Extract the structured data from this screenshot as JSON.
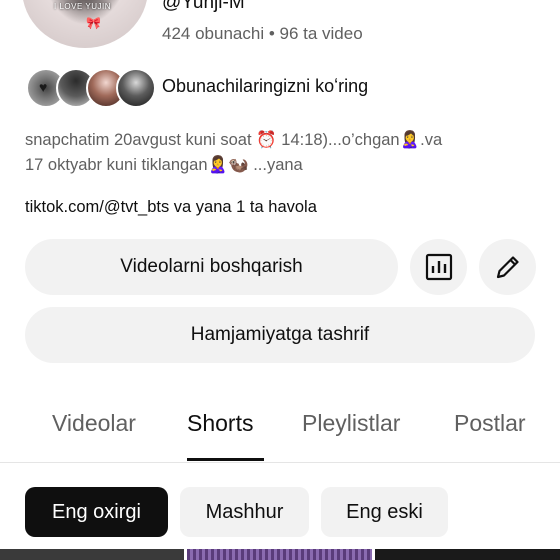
{
  "profile": {
    "avatar_caption": "I LOVE YUJIN",
    "handle": "@Yunji-M",
    "stats": "424 obunachi • 96 ta video"
  },
  "subscribers": {
    "label": "Obunachilaringizni koʻring"
  },
  "description": {
    "line1": "snapchatim 20avgust kuni soat ⏰ 14:18)...o’chgan🙎‍♀️.va",
    "line2": "17 oktyabr kuni tiklangan🙎‍♀️🦦 ...yana"
  },
  "link": "tiktok.com/@tvt_bts va yana 1 ta havola",
  "buttons": {
    "manage_videos": "Videolarni boshqarish",
    "visit_community": "Hamjamiyatga tashrif"
  },
  "tabs": [
    {
      "label": "Videolar"
    },
    {
      "label": "Shorts"
    },
    {
      "label": "Pleylistlar"
    },
    {
      "label": "Postlar"
    }
  ],
  "active_tab": "Shorts",
  "filters": [
    {
      "label": "Eng oxirgi"
    },
    {
      "label": "Mashhur"
    },
    {
      "label": "Eng eski"
    }
  ],
  "active_filter": "Eng oxirgi",
  "icons": {
    "stats": "bar-chart-icon",
    "edit": "pencil-icon"
  }
}
